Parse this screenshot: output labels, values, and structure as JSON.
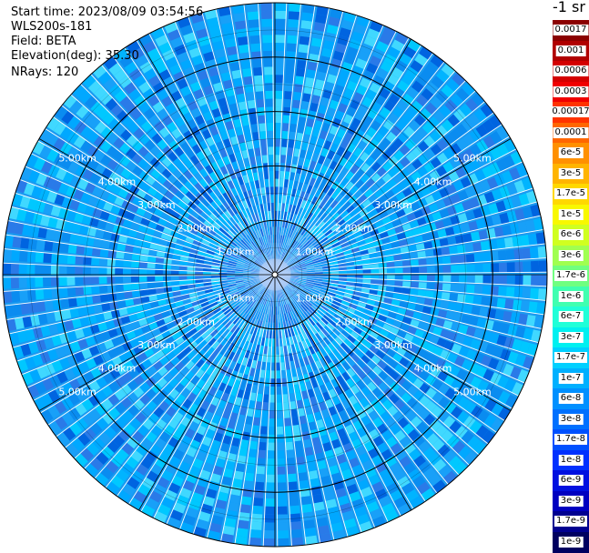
{
  "header": {
    "start_time": "Start time: 2023/08/09 03:54:56",
    "instrument": "WLS200s-181",
    "field": "Field: BETA",
    "elevation": "Elevation(deg): 35.30",
    "nrays": "NRays: 120"
  },
  "plot": {
    "n_rays": 120,
    "max_range_km": 5.0,
    "range_rings": [
      {
        "km": 1,
        "label": "1.00km"
      },
      {
        "km": 2,
        "label": "2.00km"
      },
      {
        "km": 3,
        "label": "3.00km"
      },
      {
        "km": 4,
        "label": "4.00km"
      },
      {
        "km": 5,
        "label": "5.00km"
      }
    ],
    "background_color": "#1a9af0"
  },
  "colorbar": {
    "title": "-1 sr",
    "entries": [
      {
        "label": "0.0017",
        "color": "#8b0000"
      },
      {
        "label": "0.001",
        "color": "#b00000"
      },
      {
        "label": "0.0006",
        "color": "#d40000"
      },
      {
        "label": "0.0003",
        "color": "#f00000"
      },
      {
        "label": "0.00017",
        "color": "#ff3300"
      },
      {
        "label": "0.0001",
        "color": "#ff6600"
      },
      {
        "label": "6e-5",
        "color": "#ff9000"
      },
      {
        "label": "3e-5",
        "color": "#ffb400"
      },
      {
        "label": "1.7e-5",
        "color": "#ffd800"
      },
      {
        "label": "1e-5",
        "color": "#f8f800"
      },
      {
        "label": "6e-6",
        "color": "#d0ff20"
      },
      {
        "label": "3e-6",
        "color": "#a0ff50"
      },
      {
        "label": "1.7e-6",
        "color": "#70ff80"
      },
      {
        "label": "1e-6",
        "color": "#40ffb0"
      },
      {
        "label": "6e-7",
        "color": "#20ffd8"
      },
      {
        "label": "3e-7",
        "color": "#00f0f0"
      },
      {
        "label": "1.7e-7",
        "color": "#00d0ff"
      },
      {
        "label": "1e-7",
        "color": "#00b0ff"
      },
      {
        "label": "6e-8",
        "color": "#0090ff"
      },
      {
        "label": "3e-8",
        "color": "#0070ff"
      },
      {
        "label": "1.7e-8",
        "color": "#0050ff"
      },
      {
        "label": "1e-8",
        "color": "#0030ff"
      },
      {
        "label": "6e-9",
        "color": "#0010e0"
      },
      {
        "label": "3e-9",
        "color": "#0000c0"
      },
      {
        "label": "1.7e-9",
        "color": "#000090"
      },
      {
        "label": "1e-9",
        "color": "#000060"
      }
    ]
  }
}
